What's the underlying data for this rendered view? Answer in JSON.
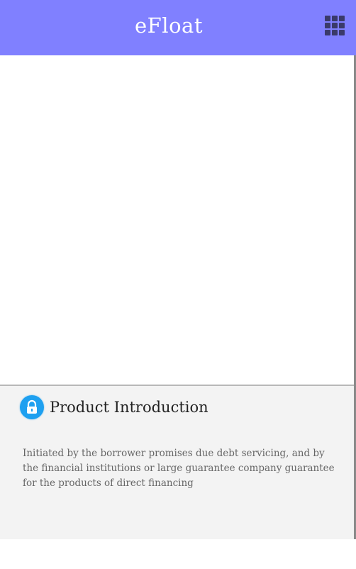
{
  "header": {
    "title": "eFloat",
    "menu_icon": "grid-icon",
    "background_color": "#8080ff"
  },
  "banner": {},
  "intro": {
    "icon": "lock-icon",
    "icon_color": "#1ea0f0",
    "heading": "Product Introduction",
    "body": "Initiated by the borrower promises due debt servicing, and by the financial institutions or large guarantee company guarantee for the products of direct financing"
  }
}
